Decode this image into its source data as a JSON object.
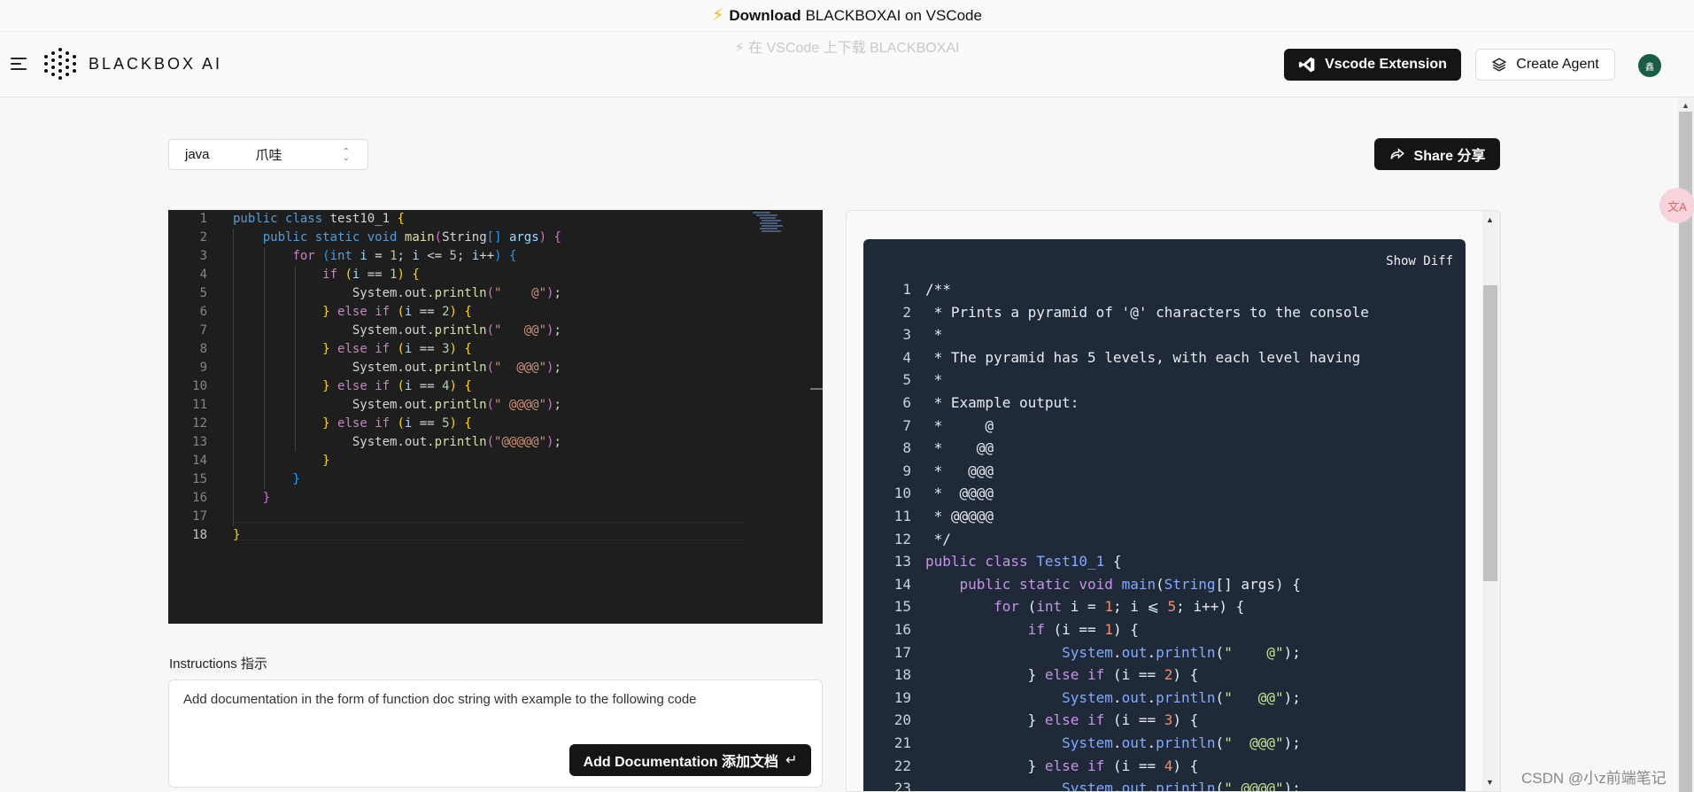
{
  "banner": {
    "prefix": "Download",
    "text": "BLACKBOXAI on VSCode",
    "subtext": "⚡ 在 VSCode 上下载 BLACKBOXAI"
  },
  "header": {
    "logo_text": "BLACKBOX AI",
    "vscode_button": "Vscode Extension",
    "create_agent_button": "Create Agent",
    "avatar_text": "鑫"
  },
  "language_select": {
    "value": "java",
    "value_cn": "爪哇"
  },
  "share_button": "Share 分享",
  "editor": {
    "lines": [
      "1",
      "2",
      "3",
      "4",
      "5",
      "6",
      "7",
      "8",
      "9",
      "10",
      "11",
      "12",
      "13",
      "14",
      "15",
      "16",
      "17",
      "18"
    ]
  },
  "instructions": {
    "label": "Instructions 指示",
    "text": "Add documentation in the form of function doc string with example to the following code",
    "button": "Add Documentation  添加文档",
    "enter_symbol": "↵"
  },
  "result": {
    "show_diff": "Show Diff"
  },
  "watermark": "CSDN @小z前端笔记",
  "translate_widget": "文A",
  "colors": {
    "editor_bg": "#1e1e1e",
    "result_bg": "#1f2937",
    "button_dark": "#151515",
    "avatar_bg": "#1a5c44"
  }
}
